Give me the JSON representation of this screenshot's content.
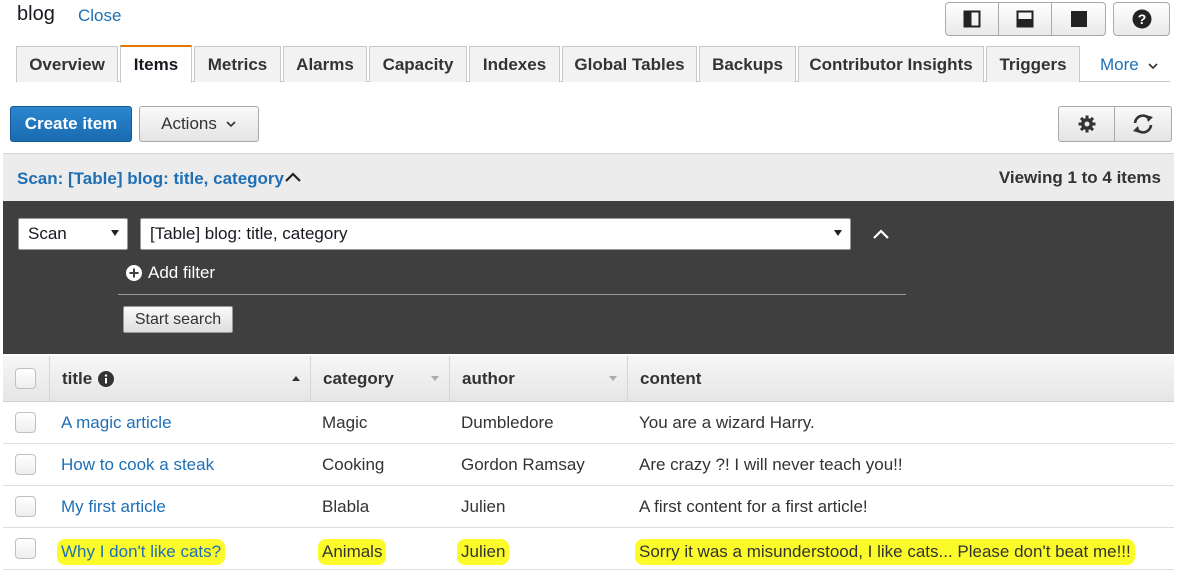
{
  "header": {
    "table_name": "blog",
    "close_label": "Close"
  },
  "tabs": [
    {
      "label": "Overview",
      "active": false
    },
    {
      "label": "Items",
      "active": true
    },
    {
      "label": "Metrics",
      "active": false
    },
    {
      "label": "Alarms",
      "active": false
    },
    {
      "label": "Capacity",
      "active": false
    },
    {
      "label": "Indexes",
      "active": false
    },
    {
      "label": "Global Tables",
      "active": false
    },
    {
      "label": "Backups",
      "active": false
    },
    {
      "label": "Contributor Insights",
      "active": false
    },
    {
      "label": "Triggers",
      "active": false
    }
  ],
  "tabs_more": "More",
  "toolbar": {
    "create_label": "Create item",
    "actions_label": "Actions",
    "accent_color": "#1a6bb0"
  },
  "scan": {
    "title": "Scan: [Table] blog: title, category",
    "viewing": "Viewing 1 to 4 items",
    "mode_value": "Scan",
    "target_value": "[Table] blog: title, category",
    "add_filter_label": "Add filter",
    "start_search_label": "Start search"
  },
  "grid": {
    "columns": [
      "title",
      "category",
      "author",
      "content"
    ],
    "rows": [
      {
        "title": "A magic article",
        "category": "Magic",
        "author": "Dumbledore",
        "content": "You are a wizard Harry.",
        "highlighted": false
      },
      {
        "title": "How to cook a steak",
        "category": "Cooking",
        "author": "Gordon Ramsay",
        "content": "Are crazy ?! I will never teach you!!",
        "highlighted": false
      },
      {
        "title": "My first article",
        "category": "Blabla",
        "author": "Julien",
        "content": "A first content for a first article!",
        "highlighted": false
      },
      {
        "title": "Why I don't like cats?",
        "category": "Animals",
        "author": "Julien",
        "content": "Sorry it was a misunderstood, I like cats... Please don't beat me!!!",
        "highlighted": true
      }
    ],
    "highlight_color": "#fbfb2a"
  }
}
